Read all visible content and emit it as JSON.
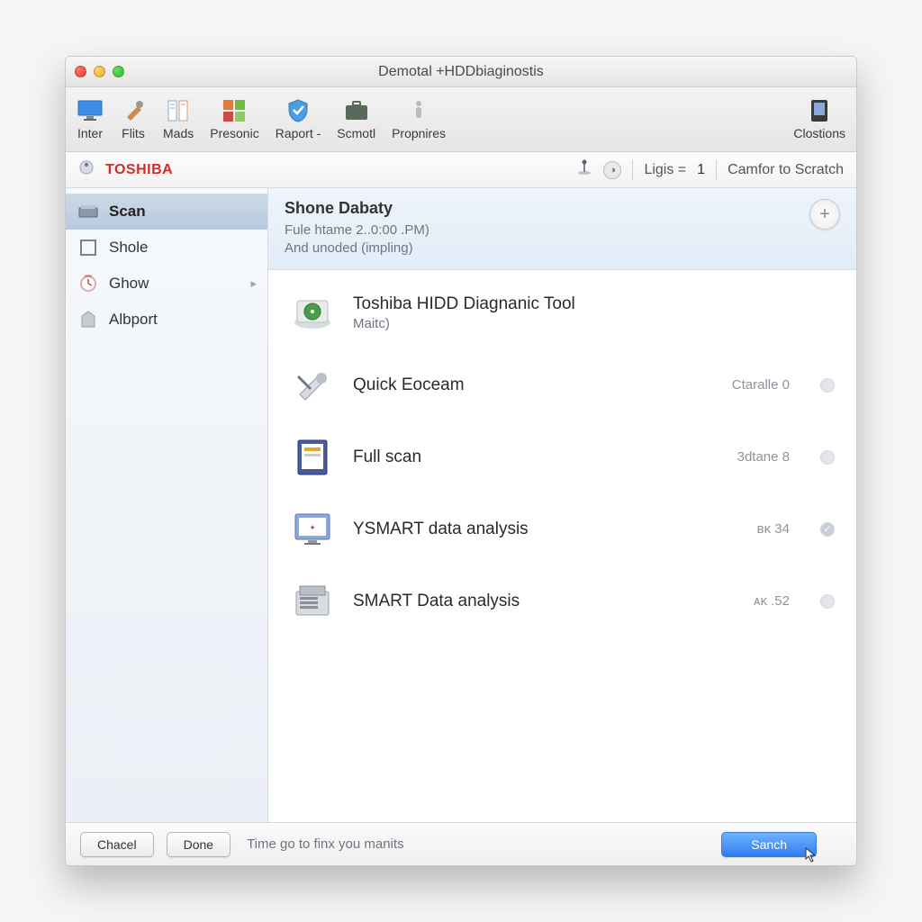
{
  "window": {
    "title": "Demotal +HDDbiaginostis"
  },
  "toolbar": [
    {
      "id": "inter",
      "label": "Inter",
      "icon": "monitor"
    },
    {
      "id": "flits",
      "label": "Flits",
      "icon": "tools"
    },
    {
      "id": "mads",
      "label": "Mads",
      "icon": "docs"
    },
    {
      "id": "presonic",
      "label": "Presonic",
      "icon": "grid"
    },
    {
      "id": "raport",
      "label": "Raport -",
      "icon": "shield"
    },
    {
      "id": "scmotl",
      "label": "Scmotl",
      "icon": "briefcase"
    },
    {
      "id": "propnires",
      "label": "Propnires",
      "icon": "person"
    },
    {
      "id": "clostions",
      "label": "Clostions",
      "icon": "device"
    }
  ],
  "infobar": {
    "brand": "TOSHIBA",
    "ligis_label": "Ligis =",
    "ligis_value": "1",
    "camfor": "Camfor to Scratch"
  },
  "sidebar": {
    "items": [
      {
        "id": "scan",
        "label": "Scan",
        "icon": "scanner",
        "active": true
      },
      {
        "id": "shole",
        "label": "Shole",
        "icon": "square"
      },
      {
        "id": "ghow",
        "label": "Ghow",
        "icon": "clock",
        "chev": true
      },
      {
        "id": "albport",
        "label": "Albport",
        "icon": "tag"
      }
    ]
  },
  "panel": {
    "title": "Shone Dabaty",
    "sub1": "Fule htame 2..0:00 .PM)",
    "sub2": "And unoded (impling)"
  },
  "items": [
    {
      "id": "tool",
      "label": "Toshiba HIDD Diagnanic Tool",
      "sublabel": "Maitc)",
      "meta": "",
      "icon": "hdd"
    },
    {
      "id": "quick",
      "label": "Quick Eoceam",
      "meta": "Ctaralle 0",
      "icon": "wrench"
    },
    {
      "id": "full",
      "label": "Full scan",
      "meta": "3dtane 8",
      "icon": "drive"
    },
    {
      "id": "ysmart",
      "label": "YSMART data analysis",
      "meta": "ʙᴋ 34",
      "icon": "display",
      "check": true
    },
    {
      "id": "smart",
      "label": "SMART Data analysis",
      "meta": "ᴀᴋ .52",
      "icon": "server"
    }
  ],
  "footer": {
    "cancel": "Chacel",
    "done": "Done",
    "hint": "Time go to finx you manits",
    "primary": "Sanch"
  }
}
